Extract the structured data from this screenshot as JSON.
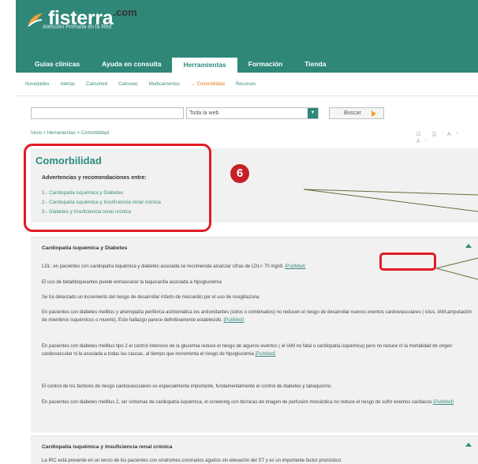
{
  "site": {
    "name": "fisterra",
    "domain": ".com",
    "tagline": "Atención Primaria en la Red"
  },
  "tabs": [
    {
      "label": "Guías clínicas",
      "active": false
    },
    {
      "label": "Ayuda en consulta",
      "active": false
    },
    {
      "label": "Herramientas",
      "active": true
    },
    {
      "label": "Formación",
      "active": false
    },
    {
      "label": "Tienda",
      "active": false
    }
  ],
  "subnav": [
    {
      "label": "Novedades",
      "current": false
    },
    {
      "label": "Alertas",
      "current": false
    },
    {
      "label": "Calcumed",
      "current": false
    },
    {
      "label": "Calcuvac",
      "current": false
    },
    {
      "label": "Medicamentos",
      "current": false
    },
    {
      "label": "→ Comorbilidad",
      "current": true
    },
    {
      "label": "Recursos",
      "current": false
    }
  ],
  "search": {
    "value": "",
    "scope": "Toda la web",
    "button_label": "Buscar"
  },
  "breadcrumb": "Inicio > Herramientas > Comorbilidad",
  "page_tools": "⊡ ⎙ A⁺ A⁻",
  "intro": {
    "title": "Comorbilidad",
    "label": "Advertencias y recomendaciones entre:",
    "items": [
      "1.- Cardiopatía isquémica y Diabetes",
      "2.- Cardiopatía isquémica y Insuficiencia renal crónica",
      "3.- Diabetes y Insuficiencia renal crónica"
    ]
  },
  "annotation": {
    "badge": "6"
  },
  "sections": [
    {
      "heading": "Cardiopatía isquémica y Diabetes",
      "paragraphs": [
        {
          "text": "LDL: en pacientes con cardiopatía isquémica y diabetes asociada se recomienda alcanzar cifras de LDL< 70 mg/dl. ",
          "link": "[PubMed]"
        },
        {
          "text": "El uso de betabloqueantes puede enmascarar la taquicardia asociada a hipoglucemia",
          "link": ""
        },
        {
          "text": "Se ha detectado un incremento del riesgo de desarrollar infarto de miocardio por el uso de rosiglitazona",
          "link": ""
        },
        {
          "text": "En pacientes con diabetes mellitus y arteriopatía periférica asintomática los antioxidantes (solos o combinados) no reducen el riesgo de desarrollar nuevos eventos cardiovasculares ( ictus, IAM,amputación de miembros isquémicos o muerte). Este hallazgo parece definitivamente establecido. ",
          "link": "[PubMed]"
        },
        {
          "text": "En pacientes con diabetes mellitus tipo 2 el control intensivo de la glucemia reduce el riesgo de algunos eventos ( el IAM no fatal o cardiopatía isquémica) pero no reduce ni la mortalidad de origen cardiovascular ni la asociada a todas las causas, al tiempo que incrementa el riesgo de hipoglucemia ",
          "link": "[PubMed]"
        },
        {
          "text": "El control de los factores de riesgo cardiovasculares es especialmente importante, fundamentalmente el control de diabetes y tabaquismo.",
          "link": ""
        },
        {
          "text": "En pacientes con diabetes mellitus 2, sin síntomas de cardiopatía isquémica, el screening con técnicas de imagen de perfusión miocárdica no reduce el riesgo de sufrir eventos cardiacos ",
          "link": "[PubMed]"
        }
      ]
    },
    {
      "heading": "Cardiopatía isquémica y Insuficiencia renal crónica",
      "paragraphs": [
        {
          "text": "La IRC está presente en un tercio de los pacientes con síndromes coronarios agudos sin elevación del ST y es un importante factor pronóstico.",
          "link": ""
        }
      ]
    }
  ],
  "colors": {
    "brand": "#2f8777",
    "link": "#3c8d80",
    "accent": "#e07b10",
    "highlight": "#e01b24"
  }
}
